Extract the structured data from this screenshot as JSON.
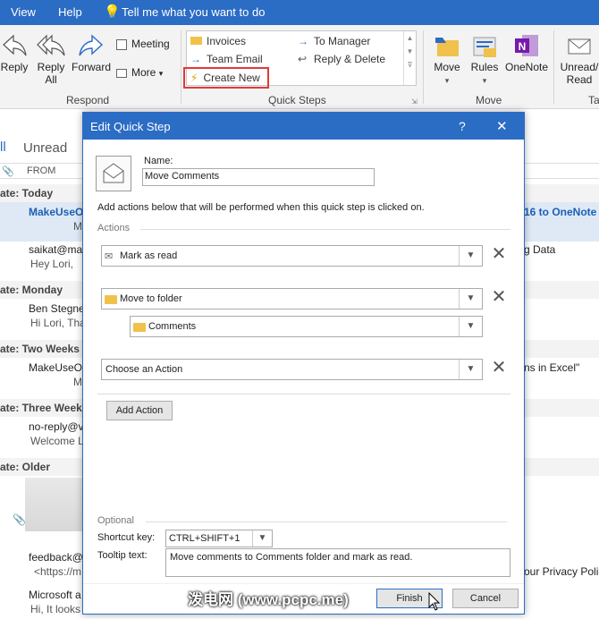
{
  "menubar": {
    "view": "View",
    "help": "Help",
    "tell_me": "Tell me what you want to do"
  },
  "ribbon": {
    "reply": "Reply",
    "reply_all_1": "Reply",
    "reply_all_2": "All",
    "forward": "Forward",
    "meeting": "Meeting",
    "more": "More",
    "respond_group": "Respond",
    "quick_steps": {
      "invoices": "Invoices",
      "team_email": "Team Email",
      "create_new": "Create New",
      "to_manager": "To Manager",
      "reply_delete": "Reply & Delete",
      "group": "Quick Steps"
    },
    "move": "Move",
    "rules": "Rules",
    "onenote": "OneNote",
    "move_group": "Move",
    "unread_1": "Unread/",
    "unread_2": "Read",
    "tags_group": "Tag"
  },
  "mail_list": {
    "filter_all": "ll",
    "filter_unread": "Unread",
    "from_col": "FROM",
    "date_today": "ate: Today",
    "item1_from": "MakeUseOf",
    "item1_sub": "M",
    "item1_right": "16 to OneNote f",
    "item2_from": "saikat@mak",
    "item2_preview": "Hey Lori,",
    "item2_right": "g Data",
    "date_monday": "ate: Monday",
    "item3_from": "Ben Stegne",
    "item3_preview": "Hi Lori,  Tha",
    "date_two_weeks": "ate: Two Weeks A",
    "item4_from": "MakeUseOf",
    "item4_sub": "M",
    "item4_right": "ns in Excel\"",
    "date_three_weeks": "ate: Three Weeks A",
    "item5_from": "no-reply@v",
    "item5_preview": "Welcome Lo",
    "date_older": "ate: Older",
    "item6_from": "feedback@",
    "item6_preview": "<https://m",
    "item6_right": "our Privacy Polic",
    "item7_from": "Microsoft a",
    "item7_preview": "Hi,  It looks"
  },
  "dialog": {
    "title": "Edit Quick Step",
    "help": "?",
    "close": "✕",
    "name_label": "Name:",
    "name_value": "Move Comments",
    "instructions": "Add actions below that will be performed when this quick step is clicked on.",
    "actions_label": "Actions",
    "action1": "Mark as read",
    "action2": "Move to folder",
    "action2_folder": "Comments",
    "action3": "Choose an Action",
    "add_action": "Add Action",
    "optional_label": "Optional",
    "shortcut_label": "Shortcut key:",
    "shortcut_value": "CTRL+SHIFT+1",
    "tooltip_label": "Tooltip text:",
    "tooltip_value": "Move comments to Comments folder and mark as read.",
    "finish": "Finish",
    "cancel": "Cancel"
  },
  "watermark": "泼电网 (www.pcpc.me)",
  "colors": {
    "accent": "#2b6cc4",
    "highlight": "#e03a3a",
    "link_blue": "#1a5fb4"
  }
}
